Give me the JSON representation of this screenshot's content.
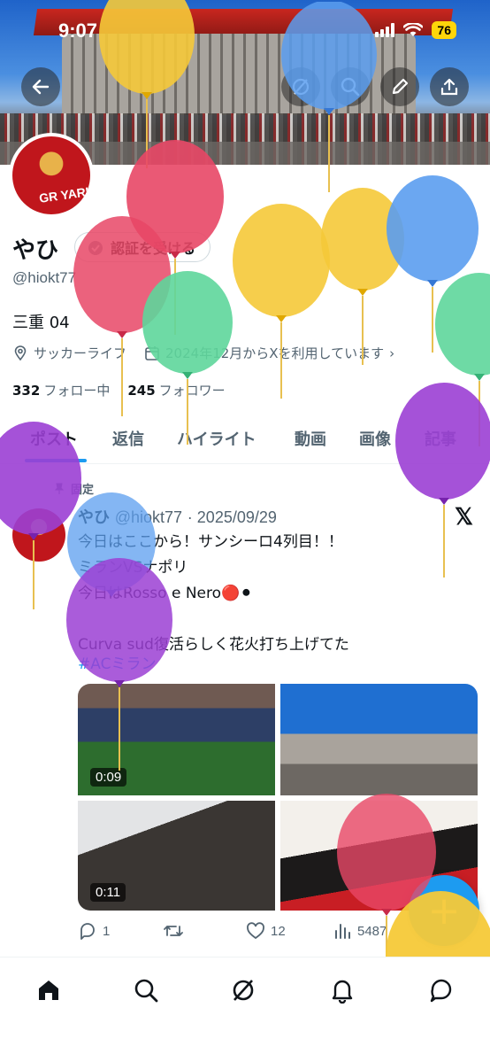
{
  "status_bar": {
    "time": "9:07",
    "battery": "76"
  },
  "profile": {
    "name": "やひ",
    "verify_label": "認証を受ける",
    "handle": "@hiokt77",
    "bio": "三重 04",
    "category": "サッカーライフ",
    "joined": "2024年12月からXを利用しています",
    "following_count": "332",
    "following_label": "フォロー中",
    "followers_count": "245",
    "followers_label": "フォロワー"
  },
  "tabs": [
    "ポスト",
    "返信",
    "ハイライト",
    "動画",
    "画像",
    "記事"
  ],
  "post": {
    "pinned_label": "固定",
    "author": "やひ",
    "handle": "@hiokt77",
    "date": "· 2025/09/29",
    "text": "今日はここから！サンシーロ4列目！！\nミランVSナポリ\n今日はRosso e Nero🔴⚫\n\nCurva sud復活らしく花火打ち上げてた",
    "hashtag": "#ACミラン",
    "media_durations": [
      "0:09",
      "0:11"
    ],
    "replies": "1",
    "likes": "12",
    "views": "5487"
  },
  "icons": {
    "back": "back-arrow-icon",
    "grok": "grok-icon",
    "search": "search-icon",
    "edit": "edit-icon",
    "share": "share-icon",
    "nav": [
      "home-icon",
      "search-icon",
      "grok-icon",
      "notifications-icon",
      "messages-icon"
    ]
  },
  "colors": {
    "accent": "#1d9bf0",
    "text": "#0f1419",
    "muted": "#536471",
    "battery": "#ffd60a"
  }
}
